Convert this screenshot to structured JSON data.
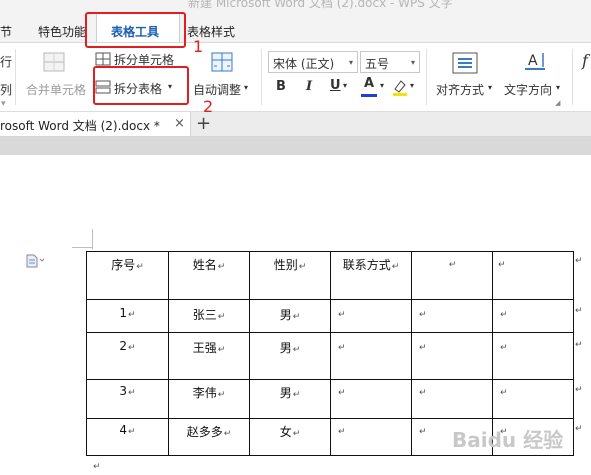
{
  "window": {
    "title": "新建 Microsoft Word 文档 (2).docx - WPS 文字"
  },
  "tabs": [
    {
      "label": "节"
    },
    {
      "label": "特色功能"
    },
    {
      "label": "表格工具",
      "active": true
    },
    {
      "label": "表格样式"
    }
  ],
  "ribbon": {
    "left_partial_top": "行",
    "left_partial_bottom": "列",
    "merge_cells": "合并单元格",
    "split_cells": "拆分单元格",
    "split_table": "拆分表格",
    "auto_fit": "自动调整",
    "font_name": "宋体 (正文)",
    "font_size": "五号",
    "bold": "B",
    "italic": "I",
    "underline": "U",
    "font_color_glyph": "A",
    "align": "对齐方式",
    "text_direction": "文字方向",
    "formula_partial": "f"
  },
  "doc_tab": {
    "name": "rosoft Word 文档 (2).docx *",
    "close": "×",
    "new": "+"
  },
  "annotations": {
    "label_1": "1",
    "label_2": "2"
  },
  "table": {
    "header": [
      "序号",
      "姓名",
      "性别",
      "联系方式",
      "",
      ""
    ],
    "rows": [
      [
        "1",
        "张三",
        "男",
        "",
        "",
        ""
      ],
      [
        "2",
        "王强",
        "男",
        "",
        "",
        ""
      ],
      [
        "3",
        "李伟",
        "男",
        "",
        "",
        ""
      ],
      [
        "4",
        "赵多多",
        "女",
        "",
        "",
        ""
      ]
    ]
  },
  "watermark": "Baidu 经验",
  "colors": {
    "accent": "#1a5fb4",
    "annotation": "#e02020",
    "font_color": "#1f3fd6",
    "highlight": "#f5e400"
  }
}
